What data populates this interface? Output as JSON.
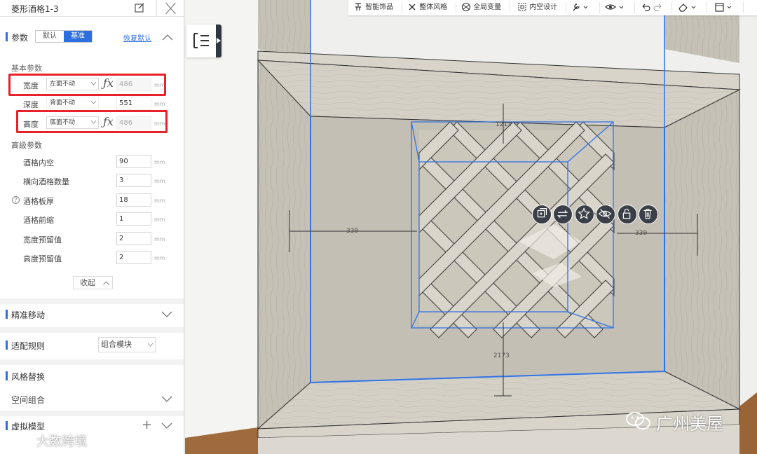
{
  "panel": {
    "title": "菱形酒格1-3",
    "params_section": "参数",
    "tabs": [
      "默认",
      "基准"
    ],
    "active_tab": 1,
    "restore_default": "恢复默认",
    "basic_group": "基本参数",
    "width": {
      "label": "宽度",
      "mode": "左面不动",
      "value": "486",
      "unit": "mm"
    },
    "depth": {
      "label": "深度",
      "mode": "背面不动",
      "value": "551",
      "unit": "mm"
    },
    "height": {
      "label": "高度",
      "mode": "底面不动",
      "value": "486",
      "unit": "mm"
    },
    "advanced_group": "高级参数",
    "advanced": [
      {
        "label": "酒格内空",
        "value": "90",
        "unit": "mm"
      },
      {
        "label": "横向酒格数量",
        "value": "3",
        "unit": "mm"
      },
      {
        "label": "酒格板厚",
        "value": "18",
        "unit": "mm"
      },
      {
        "label": "酒格前缩",
        "value": "1",
        "unit": "mm"
      },
      {
        "label": "宽度预留值",
        "value": "2",
        "unit": "mm"
      },
      {
        "label": "高度预留值",
        "value": "2",
        "unit": "mm"
      }
    ],
    "collapse": "收起",
    "precise_move": "精准移动",
    "fit_rules": "适配规则",
    "fit_rules_value": "组合模块",
    "style_replace": "风格替换",
    "space_combo": "空间组合",
    "virtual_model": "虚拟模型"
  },
  "toolbar": {
    "items": [
      "智能饰品",
      "整体风格",
      "全局变量",
      "内空设计"
    ]
  },
  "viewport": {
    "dim_top": "1211",
    "dim_left": "339",
    "dim_right": "339",
    "dim_bottom": "2173"
  },
  "watermark": {
    "left": "大数跨境",
    "right": "广州美屋"
  },
  "colors": {
    "accent": "#2b6fe0",
    "highlight": "#e8222b",
    "selection": "#2f74e8"
  }
}
